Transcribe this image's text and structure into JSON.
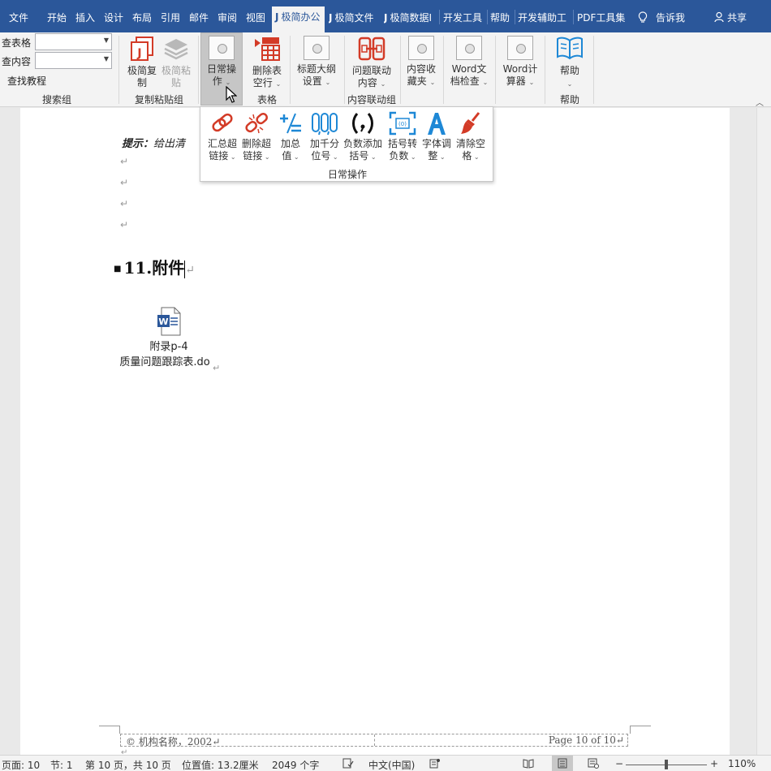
{
  "colors": {
    "ribbon_blue": "#2b579a",
    "accent_red": "#d33b27",
    "accent_blue": "#1e88d6"
  },
  "tabs": [
    {
      "label": "文件",
      "icon": "",
      "active": false
    },
    {
      "label": "开始",
      "icon": "",
      "active": false
    },
    {
      "label": "插入",
      "icon": "",
      "active": false
    },
    {
      "label": "设计",
      "icon": "",
      "active": false
    },
    {
      "label": "布局",
      "icon": "",
      "active": false
    },
    {
      "label": "引用",
      "icon": "",
      "active": false
    },
    {
      "label": "邮件",
      "icon": "",
      "active": false
    },
    {
      "label": "审阅",
      "icon": "",
      "active": false
    },
    {
      "label": "视图",
      "icon": "",
      "active": false
    },
    {
      "label": "极简办公",
      "icon": "J",
      "active": true
    },
    {
      "label": "极简文件",
      "icon": "J",
      "active": false
    },
    {
      "label": "极简数据I",
      "icon": "J",
      "active": false
    },
    {
      "label": "开发工具",
      "icon": "",
      "active": false
    },
    {
      "label": "帮助",
      "icon": "",
      "active": false
    },
    {
      "label": "开发辅助工",
      "icon": "",
      "active": false
    },
    {
      "label": "PDF工具集",
      "icon": "",
      "active": false
    }
  ],
  "tell_me": "告诉我",
  "share": "共享",
  "search_group": {
    "row1": "查表格",
    "row2": "查内容",
    "row3": "查找教程",
    "label": "搜索组"
  },
  "ribbon_buttons": {
    "jijian_copy": "极简复\n制",
    "jijian_paste": "极简粘\n贴",
    "copy_paste_group": "复制粘贴组",
    "daily_ops": "日常操\n作",
    "delete_table_rows": "删除表\n空行",
    "table_group": "表格",
    "outline_settings": "标题大纲\n设置",
    "issue_link": "问题联动\n内容",
    "content_link_group": "内容联动组",
    "content_fav": "内容收\n藏夹",
    "word_check": "Word文\n档检查",
    "word_calc": "Word计\n算器",
    "help": "帮助",
    "help_group": "帮助"
  },
  "dropdown": {
    "items": [
      {
        "label": "汇总超\n链接",
        "icon": "link-icon"
      },
      {
        "label": "删除超\n链接",
        "icon": "unlink-icon"
      },
      {
        "label": "加总\n值",
        "icon": "sum-icon"
      },
      {
        "label": "加千分\n位号",
        "icon": "thousands-icon"
      },
      {
        "label": "负数添加\n括号",
        "icon": "paren-icon"
      },
      {
        "label": "括号转\n负数",
        "icon": "bracket-icon"
      },
      {
        "label": "字体调\n整",
        "icon": "font-icon"
      },
      {
        "label": "清除空\n格",
        "icon": "broom-icon"
      }
    ],
    "group_label": "日常操作"
  },
  "document": {
    "hint_label": "提示：",
    "hint_text": "给出清",
    "para_mark": "↵",
    "heading_number": "11.",
    "heading_text": "附件",
    "attachment_line1": "附录p-4",
    "attachment_line2": "质量问题跟踪表.do",
    "footer_left": "© 机构名称，2002↵",
    "footer_right": "Page 10 of 10↵"
  },
  "status": {
    "page": "页面: 10",
    "section": "节: 1",
    "page_of": "第 10 页，共 10 页",
    "position": "位置值: 13.2厘米",
    "words": "2049 个字",
    "language": "中文(中国)",
    "zoom": "110%",
    "zoom_level_percent": 110
  }
}
